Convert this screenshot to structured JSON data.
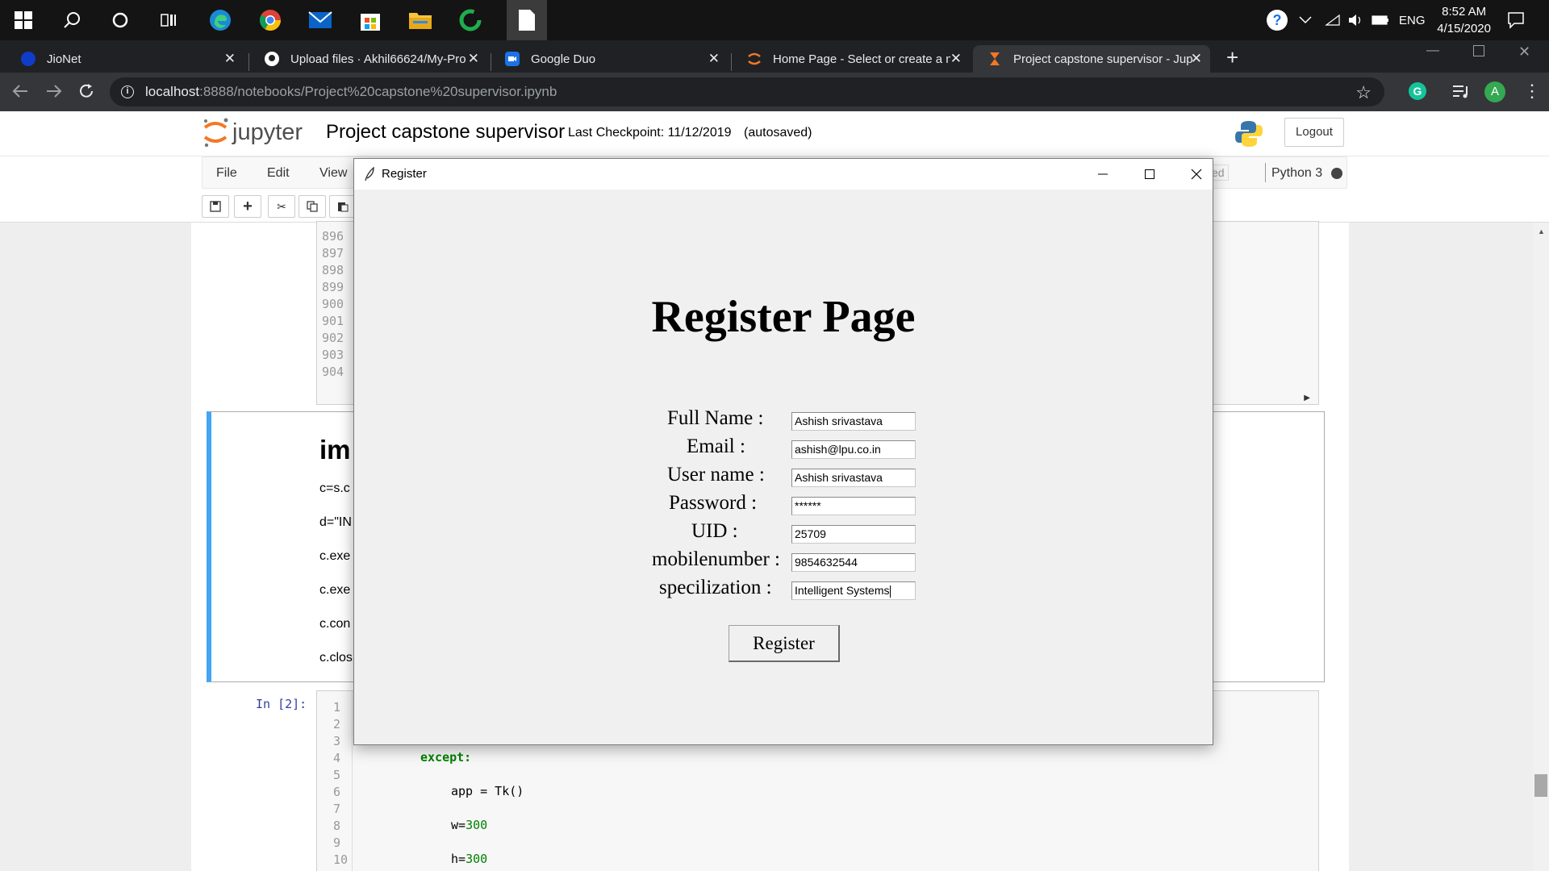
{
  "taskbar": {
    "clock_time": "8:52 AM",
    "clock_date": "4/15/2020",
    "language": "ENG"
  },
  "browser": {
    "tabs": [
      {
        "label": "JioNet"
      },
      {
        "label": "Upload files · Akhil66624/My-Pro"
      },
      {
        "label": "Google Duo"
      },
      {
        "label": "Home Page - Select or create a n"
      },
      {
        "label": "Project capstone supervisor - Jup"
      }
    ],
    "url_host": "localhost",
    "url_rest": ":8888/notebooks/Project%20capstone%20supervisor.ipynb",
    "avatar_letter": "A"
  },
  "jupyter": {
    "logo_text": "jupyter",
    "notebook_name": "Project capstone supervisor",
    "checkpoint": "Last Checkpoint: 11/12/2019",
    "autosaved": "(autosaved)",
    "logout_label": "Logout",
    "menus": [
      "File",
      "Edit",
      "View"
    ],
    "trusted_fragment": "ed",
    "kernel_name": "Python 3",
    "line_numbers_top": [
      "896",
      "897",
      "898",
      "899",
      "900",
      "901",
      "902",
      "903",
      "904"
    ],
    "markdown_heading_fragment": "im",
    "markdown_lines": [
      "c=s.c",
      "d=\"IN",
      "c.exe",
      "c.exe",
      "c.con",
      "c.clos"
    ],
    "cell_prompt": "In [2]:",
    "line_numbers_bottom": [
      "1",
      "2",
      "3",
      "4",
      "5",
      "6",
      "7",
      "8",
      "9",
      "10"
    ],
    "code_except": "except:",
    "code_app": "app = Tk()",
    "code_w_var": "w=",
    "code_w_val": "300",
    "code_h_var": "h=",
    "code_h_val": "300"
  },
  "dialog": {
    "window_title": "Register",
    "heading": "Register Page",
    "fields": [
      {
        "label": "Full Name  :",
        "value": "Ashish srivastava"
      },
      {
        "label": "Email  :",
        "value": "ashish@lpu.co.in"
      },
      {
        "label": "User name  :",
        "value": "Ashish srivastava"
      },
      {
        "label": "Password  :",
        "value": "******"
      },
      {
        "label": "UID  :",
        "value": "25709"
      },
      {
        "label": "mobilenumber  :",
        "value": "9854632544"
      },
      {
        "label": "specilization  :",
        "value": "Intelligent Systems"
      }
    ],
    "register_button": "Register"
  }
}
